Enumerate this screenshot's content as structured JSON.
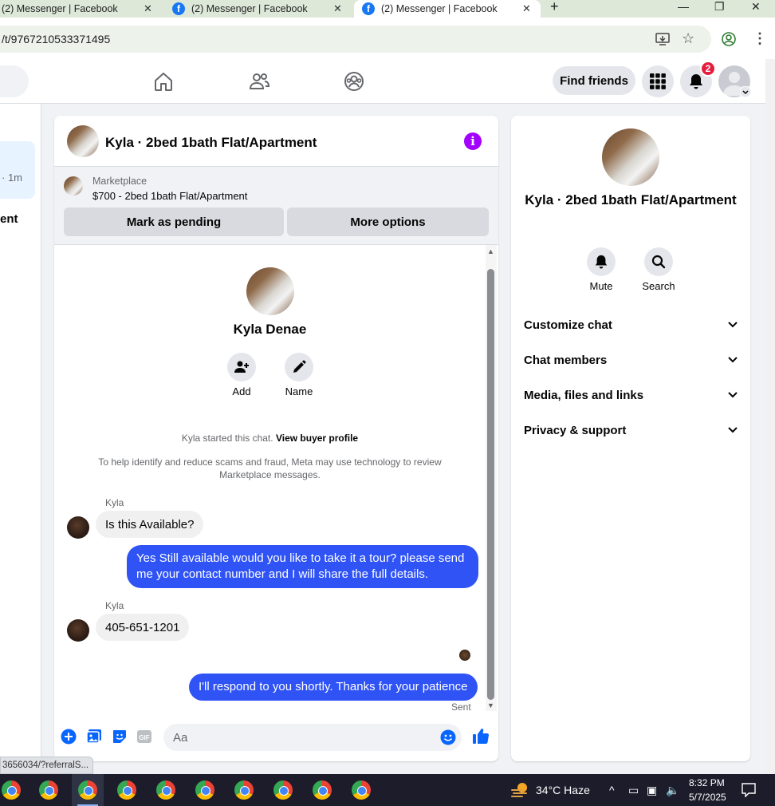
{
  "browser": {
    "tabs": [
      {
        "title": "(2) Messenger | Facebook",
        "active": false
      },
      {
        "title": "(2) Messenger | Facebook",
        "active": false
      },
      {
        "title": "(2) Messenger | Facebook",
        "active": true
      }
    ],
    "new_tab": "+",
    "url": "/t/9767210533371495",
    "status_link": "3656034/?referralS..."
  },
  "nav": {
    "find_friends": "Find friends",
    "notification_count": "2"
  },
  "left": {
    "time": "· 1m",
    "text": "ent"
  },
  "chat": {
    "title": "Kyla · 2bed 1bath Flat/Apartment",
    "marketplace_label": "Marketplace",
    "listing": "$700 - 2bed 1bath Flat/Apartment",
    "mark_pending": "Mark as pending",
    "more_options": "More options",
    "contact_name": "Kyla Denae",
    "actions": [
      {
        "label": "Add",
        "icon": "add-person-icon"
      },
      {
        "label": "Name",
        "icon": "pencil-icon"
      }
    ],
    "started_prefix": "Kyla started this chat.",
    "view_profile": "View buyer profile",
    "scam_note": "To help identify and reduce scams and fraud, Meta may use technology to review Marketplace messages.",
    "messages": [
      {
        "from": "Kyla",
        "text": "Is this Available?"
      },
      {
        "from": "me",
        "text": "Yes Still available would you like to take it a tour? please send me your contact number and I will share the full details."
      },
      {
        "from": "Kyla",
        "text": "405-651-1201"
      },
      {
        "from": "me",
        "text": "I'll respond to you shortly. Thanks for your patience"
      }
    ],
    "sent_label": "Sent",
    "composer_placeholder": "Aa"
  },
  "right": {
    "title": "Kyla · 2bed 1bath Flat/Apartment",
    "actions": [
      {
        "label": "Mute",
        "icon": "bell-icon"
      },
      {
        "label": "Search",
        "icon": "search-icon"
      }
    ],
    "sections": [
      "Customize chat",
      "Chat members",
      "Media, files and links",
      "Privacy & support"
    ]
  },
  "taskbar": {
    "weather": "34°C  Haze",
    "time": "8:32 PM",
    "date": "5/7/2025"
  },
  "colors": {
    "accent_blue": "#2f53f5",
    "info_purple": "#a200ff",
    "badge_red": "#e41e3f"
  }
}
